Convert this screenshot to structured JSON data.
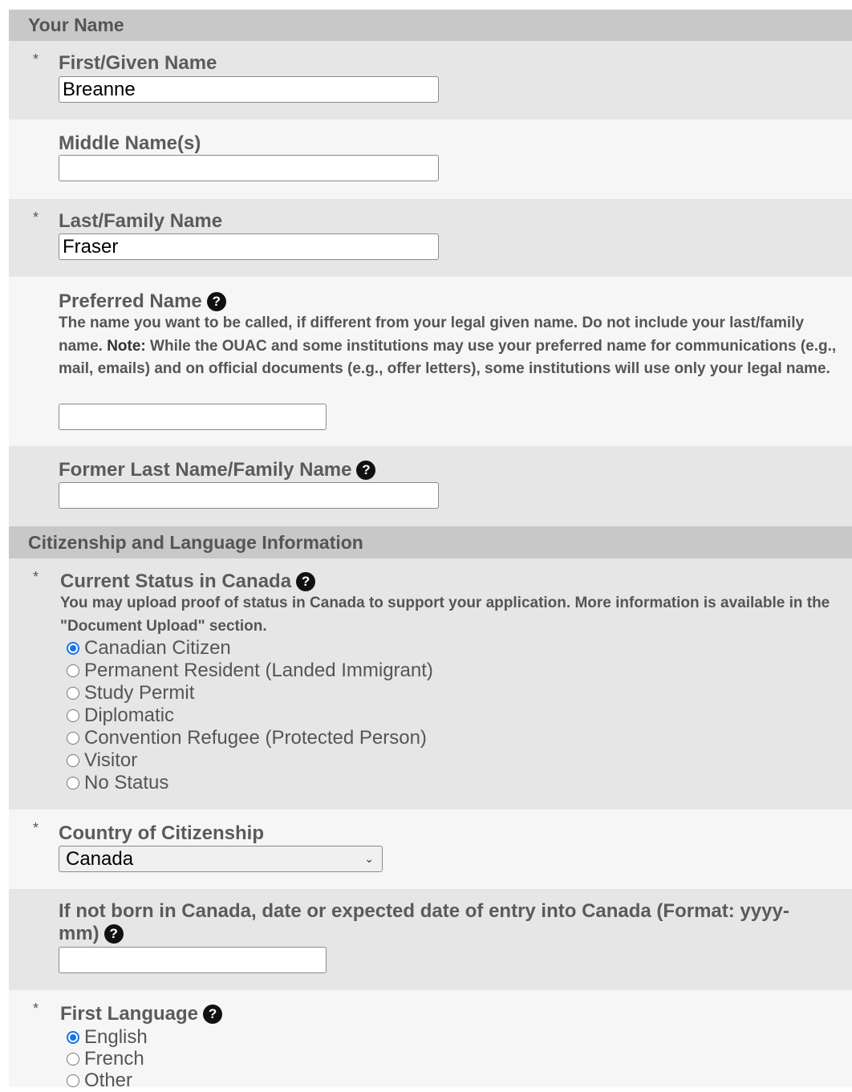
{
  "sections": {
    "your_name": "Your Name",
    "citizenship": "Citizenship and Language Information"
  },
  "required_mark": "*",
  "help_icon": "?",
  "fields": {
    "first_name": {
      "label": "First/Given Name",
      "value": "Breanne"
    },
    "middle_name": {
      "label": "Middle Name(s)",
      "value": ""
    },
    "last_name": {
      "label": "Last/Family Name",
      "value": "Fraser"
    },
    "preferred_name": {
      "label": "Preferred Name",
      "desc_1": "The name you want to be called, if different from your legal given name. Do not include your last/family name.",
      "desc_note": "Note:",
      "desc_2": "While the OUAC and some institutions may use your preferred name for communications (e.g., mail, emails) and on official documents (e.g., offer letters), some institutions will use only your legal name.",
      "value": ""
    },
    "former_last_name": {
      "label": "Former Last Name/Family Name",
      "value": ""
    },
    "current_status": {
      "label": "Current Status in Canada",
      "desc": "You may upload proof of status in Canada to support your application. More information is available in the \"Document Upload\" section.",
      "options": [
        "Canadian Citizen",
        "Permanent Resident (Landed Immigrant)",
        "Study Permit",
        "Diplomatic",
        "Convention Refugee (Protected Person)",
        "Visitor",
        "No Status"
      ],
      "selected": "Canadian Citizen"
    },
    "country": {
      "label": "Country of Citizenship",
      "value": "Canada"
    },
    "entry_date": {
      "label": "If not born in Canada, date or expected date of entry into Canada (Format: yyyy-mm)",
      "value": ""
    },
    "first_language": {
      "label": "First Language",
      "options": [
        "English",
        "French",
        "Other"
      ],
      "selected": "English"
    }
  },
  "colors": {
    "header_bg": "#c8c8c8",
    "row_dark": "#e6e6e6",
    "row_light": "#f6f6f6",
    "radio_accent": "#1a73e8"
  }
}
